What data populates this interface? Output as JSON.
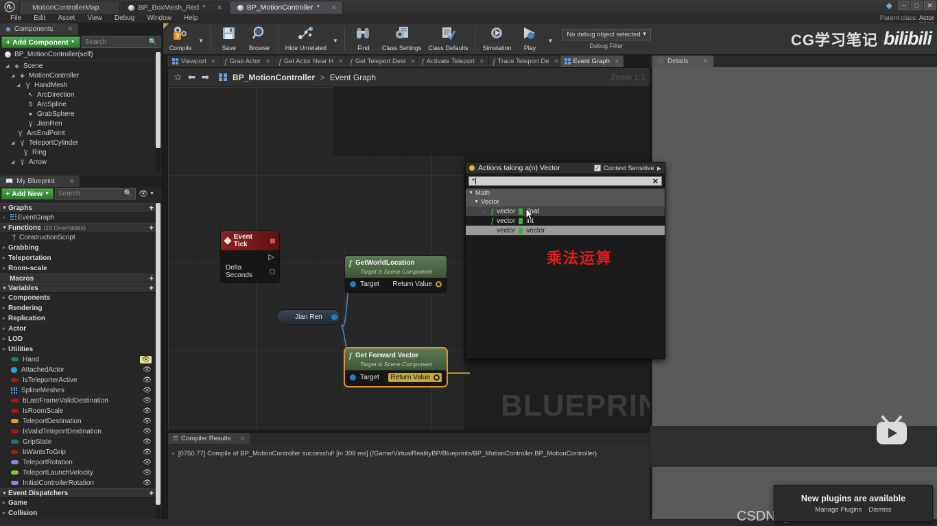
{
  "titlebar": {
    "logo": "ue-logo",
    "tabs": [
      {
        "label": "MotionControllerMap",
        "type": "map",
        "active": false
      },
      {
        "label": "BP_BoxMesh_Red",
        "type": "blueprint",
        "active": false
      },
      {
        "label": "BP_MotionController",
        "type": "blueprint",
        "active": true
      }
    ],
    "window_controls": [
      "minimize",
      "maximize",
      "close"
    ],
    "minimize_glyph": "─",
    "maximize_glyph": "□",
    "close_glyph": "✕"
  },
  "menubar": {
    "items": [
      "File",
      "Edit",
      "Asset",
      "View",
      "Debug",
      "Window",
      "Help"
    ],
    "parent_class_label": "Parent class:",
    "parent_class_value": "Actor"
  },
  "toolbar": {
    "buttons": [
      {
        "label": "Compile",
        "icon": "compile-gears-question",
        "glyph": "⚙",
        "has_caret": true
      },
      {
        "label": "Save",
        "icon": "floppy-disk-icon",
        "glyph": "💾",
        "has_caret": false
      },
      {
        "label": "Browse",
        "icon": "magnifier-icon",
        "glyph": "🔍",
        "has_caret": false
      },
      {
        "label": "Hide Unrelated",
        "icon": "node-graph-icon",
        "glyph": "⛓",
        "has_caret": true
      },
      {
        "label": "Find",
        "icon": "binoculars-icon",
        "glyph": "🔭",
        "has_caret": false
      },
      {
        "label": "Class Settings",
        "icon": "gear-document-icon",
        "glyph": "⚙",
        "has_caret": false
      },
      {
        "label": "Class Defaults",
        "icon": "checklist-icon",
        "glyph": "📋",
        "has_caret": false
      },
      {
        "label": "Simulation",
        "icon": "simulate-gear-icon",
        "glyph": "⚙",
        "has_caret": false
      },
      {
        "label": "Play",
        "icon": "play-triangle-icon",
        "glyph": "▶",
        "has_caret": true
      }
    ],
    "debug_filter": {
      "selected": "No debug object selected",
      "label": "Debug Filter"
    },
    "brand": {
      "text": "CG学习笔记",
      "logo": "bilibili"
    }
  },
  "components_panel": {
    "tab_label": "Components",
    "add_button": "Add Component",
    "search_placeholder": "Search",
    "root": "BP_MotionController(self)",
    "tree": [
      {
        "label": "Scene",
        "depth": 0,
        "icon": "scene-icon",
        "glyph": "◈",
        "expander": "◢"
      },
      {
        "label": "MotionController",
        "depth": 1,
        "icon": "scene-icon",
        "glyph": "◈",
        "expander": "◢"
      },
      {
        "label": "HandMesh",
        "depth": 2,
        "icon": "skeletal-mesh-icon",
        "glyph": "Ɣ",
        "expander": "◢"
      },
      {
        "label": "ArcDirection",
        "depth": 3,
        "icon": "arrow-component-icon",
        "glyph": "↖",
        "expander": ""
      },
      {
        "label": "ArcSpline",
        "depth": 3,
        "icon": "spline-icon",
        "glyph": "S",
        "expander": ""
      },
      {
        "label": "GrabSphere",
        "depth": 3,
        "icon": "sphere-icon",
        "glyph": "●",
        "expander": ""
      },
      {
        "label": "JianRen",
        "depth": 3,
        "icon": "static-mesh-icon",
        "glyph": "Ɣ",
        "expander": ""
      },
      {
        "label": "ArcEndPoint",
        "depth": 2,
        "icon": "static-mesh-icon",
        "glyph": "Ɣ",
        "expander": ""
      },
      {
        "label": "TeleportCylinder",
        "depth": 2,
        "icon": "static-mesh-icon",
        "glyph": "Ɣ",
        "expander": "◢"
      },
      {
        "label": "Ring",
        "depth": 3,
        "icon": "static-mesh-icon",
        "glyph": "Ɣ",
        "expander": ""
      },
      {
        "label": "Arrow",
        "depth": 2,
        "icon": "static-mesh-icon",
        "glyph": "Ɣ",
        "expander": "◢"
      }
    ]
  },
  "myblueprint_panel": {
    "tab_label": "My Blueprint",
    "add_button": "Add New",
    "search_placeholder": "Search",
    "sections": [
      {
        "name": "Graphs",
        "sub": "",
        "collapsible": true,
        "rows": [
          {
            "label": "EventGraph",
            "icon": "graph-icon",
            "caret": "▹",
            "kind": "graph"
          }
        ]
      },
      {
        "name": "Functions",
        "sub": "(19 Overridable)",
        "collapsible": true,
        "rows": [
          {
            "label": "ConstructionScript",
            "icon": "function-icon",
            "caret": "",
            "kind": "function"
          },
          {
            "label": "Grabbing",
            "icon": "",
            "caret": "▹",
            "kind": "category"
          },
          {
            "label": "Teleportation",
            "icon": "",
            "caret": "▹",
            "kind": "category"
          },
          {
            "label": "Room-scale",
            "icon": "",
            "caret": "▹",
            "kind": "category"
          }
        ]
      },
      {
        "name": "Macros",
        "sub": "",
        "collapsible": false,
        "rows": []
      },
      {
        "name": "Variables",
        "sub": "",
        "collapsible": true,
        "rows": [
          {
            "label": "Components",
            "icon": "",
            "caret": "▹",
            "kind": "category"
          },
          {
            "label": "Rendering",
            "icon": "",
            "caret": "▹",
            "kind": "category"
          },
          {
            "label": "Replication",
            "icon": "",
            "caret": "▹",
            "kind": "category"
          },
          {
            "label": "Actor",
            "icon": "",
            "caret": "▹",
            "kind": "category"
          },
          {
            "label": "LOD",
            "icon": "",
            "caret": "▹",
            "kind": "category"
          },
          {
            "label": "Utilities",
            "icon": "",
            "caret": "▹",
            "kind": "category"
          },
          {
            "label": "Hand",
            "icon": "pill",
            "color": "#1d7a6e",
            "kind": "var",
            "eye": "highlight"
          },
          {
            "label": "AttachedActor",
            "icon": "circle",
            "color": "#2b9fe0",
            "kind": "var",
            "eye": "normal"
          },
          {
            "label": "IsTeleporterActive",
            "icon": "pill",
            "color": "#a01818",
            "kind": "var",
            "eye": "normal"
          },
          {
            "label": "SplineMeshes",
            "icon": "grid",
            "color": "#5a9fd4",
            "kind": "var",
            "eye": "normal"
          },
          {
            "label": "bLastFrameValidDestination",
            "icon": "pill",
            "color": "#a01818",
            "kind": "var",
            "eye": "normal"
          },
          {
            "label": "IsRoomScale",
            "icon": "pill",
            "color": "#a01818",
            "kind": "var",
            "eye": "normal"
          },
          {
            "label": "TeleportDestination",
            "icon": "pill",
            "color": "#d0a32a",
            "kind": "var",
            "eye": "normal"
          },
          {
            "label": "IsValidTeleportDestination",
            "icon": "pill",
            "color": "#a01818",
            "kind": "var",
            "eye": "normal"
          },
          {
            "label": "GripState",
            "icon": "pill",
            "color": "#1d7a6e",
            "kind": "var",
            "eye": "normal"
          },
          {
            "label": "bWantsToGrip",
            "icon": "pill",
            "color": "#a01818",
            "kind": "var",
            "eye": "normal"
          },
          {
            "label": "TeleportRotation",
            "icon": "pill",
            "color": "#8a8ad8",
            "kind": "var",
            "eye": "normal"
          },
          {
            "label": "TeleportLaunchVelocity",
            "icon": "pill",
            "color": "#84c832",
            "kind": "var",
            "eye": "normal"
          },
          {
            "label": "InitialControllerRotation",
            "icon": "pill",
            "color": "#8a8ad8",
            "kind": "var",
            "eye": "normal"
          }
        ]
      },
      {
        "name": "Event Dispatchers",
        "sub": "",
        "collapsible": true,
        "rows": [
          {
            "label": "Game",
            "icon": "",
            "caret": "▹",
            "kind": "category"
          },
          {
            "label": "Collision",
            "icon": "",
            "caret": "▹",
            "kind": "category"
          }
        ]
      }
    ]
  },
  "graph_tabs": [
    {
      "label": "Viewport",
      "icon": "viewport-icon",
      "active": false
    },
    {
      "label": "Grab Actor",
      "icon": "function-icon",
      "active": false
    },
    {
      "label": "Get Actor Near H",
      "icon": "function-icon",
      "active": false
    },
    {
      "label": "Get Teleport Dest",
      "icon": "function-icon",
      "active": false
    },
    {
      "label": "Activate Teleport",
      "icon": "function-icon",
      "active": false
    },
    {
      "label": "Trace Teleport De",
      "icon": "function-icon",
      "active": false
    },
    {
      "label": "Event Graph",
      "icon": "graph-icon",
      "active": true
    }
  ],
  "details_panel": {
    "tab_label": "Details"
  },
  "graph": {
    "breadcrumb_root": "BP_MotionController",
    "breadcrumb_sep": ">",
    "breadcrumb_leaf": "Event Graph",
    "zoom_label": "Zoom 1:1",
    "watermark": "BLUEPRINT",
    "nodes": [
      {
        "id": "event-tick",
        "title": "Event Tick",
        "type": "event",
        "output_pins": [
          "Delta Seconds"
        ]
      },
      {
        "id": "getworldlocation",
        "title": "GetWorldLocation",
        "subtitle": "Target is Scene Component",
        "type": "function",
        "input_pin": "Target",
        "output_pin": "Return Value",
        "selected": false
      },
      {
        "id": "jianren",
        "title": "Jian Ren",
        "type": "variable-get"
      },
      {
        "id": "getforwardvector",
        "title": "Get Forward Vector",
        "subtitle": "Target is Scene Component",
        "type": "function",
        "input_pin": "Target",
        "output_pin": "Return Value",
        "selected": true
      }
    ]
  },
  "action_menu": {
    "title": "Actions taking a(n) Vector",
    "context_sensitive_label": "Context Sensitive",
    "context_sensitive_checked": true,
    "search_value": "*",
    "clear_glyph": "✕",
    "categories": [
      {
        "label": "Math",
        "depth": 0
      },
      {
        "label": "Vector",
        "depth": 1
      }
    ],
    "items": [
      {
        "left": "vector",
        "op": "*",
        "right": "float",
        "state": "hover",
        "favorite": true
      },
      {
        "left": "vector",
        "op": "*",
        "right": "int",
        "state": "normal",
        "favorite": false
      },
      {
        "left": "vector",
        "op": "*",
        "right": "vector",
        "state": "selected",
        "favorite": false
      }
    ]
  },
  "annotation": {
    "chinese_note": "乘法运算",
    "color": "#e21b1b"
  },
  "compiler_results": {
    "tab_label": "Compiler Results",
    "lines": [
      "[0750.77] Compile of BP_MotionController successful! [in 309 ms] (/Game/VirtualRealityBP/Blueprints/BP_MotionController.BP_MotionController)"
    ]
  },
  "notification": {
    "title": "New plugins are available",
    "buttons": [
      "Manage Plugins",
      "Dismiss"
    ]
  },
  "watermark": {
    "csdn": "CSDN @这个软件需要设计一下"
  },
  "colors": {
    "accent_green": "#3f8f3f",
    "selection_orange": "#e0952a",
    "annotation_red": "#e21b1b",
    "panel_bg": "#262626",
    "toolbar_bg": "#353535"
  }
}
